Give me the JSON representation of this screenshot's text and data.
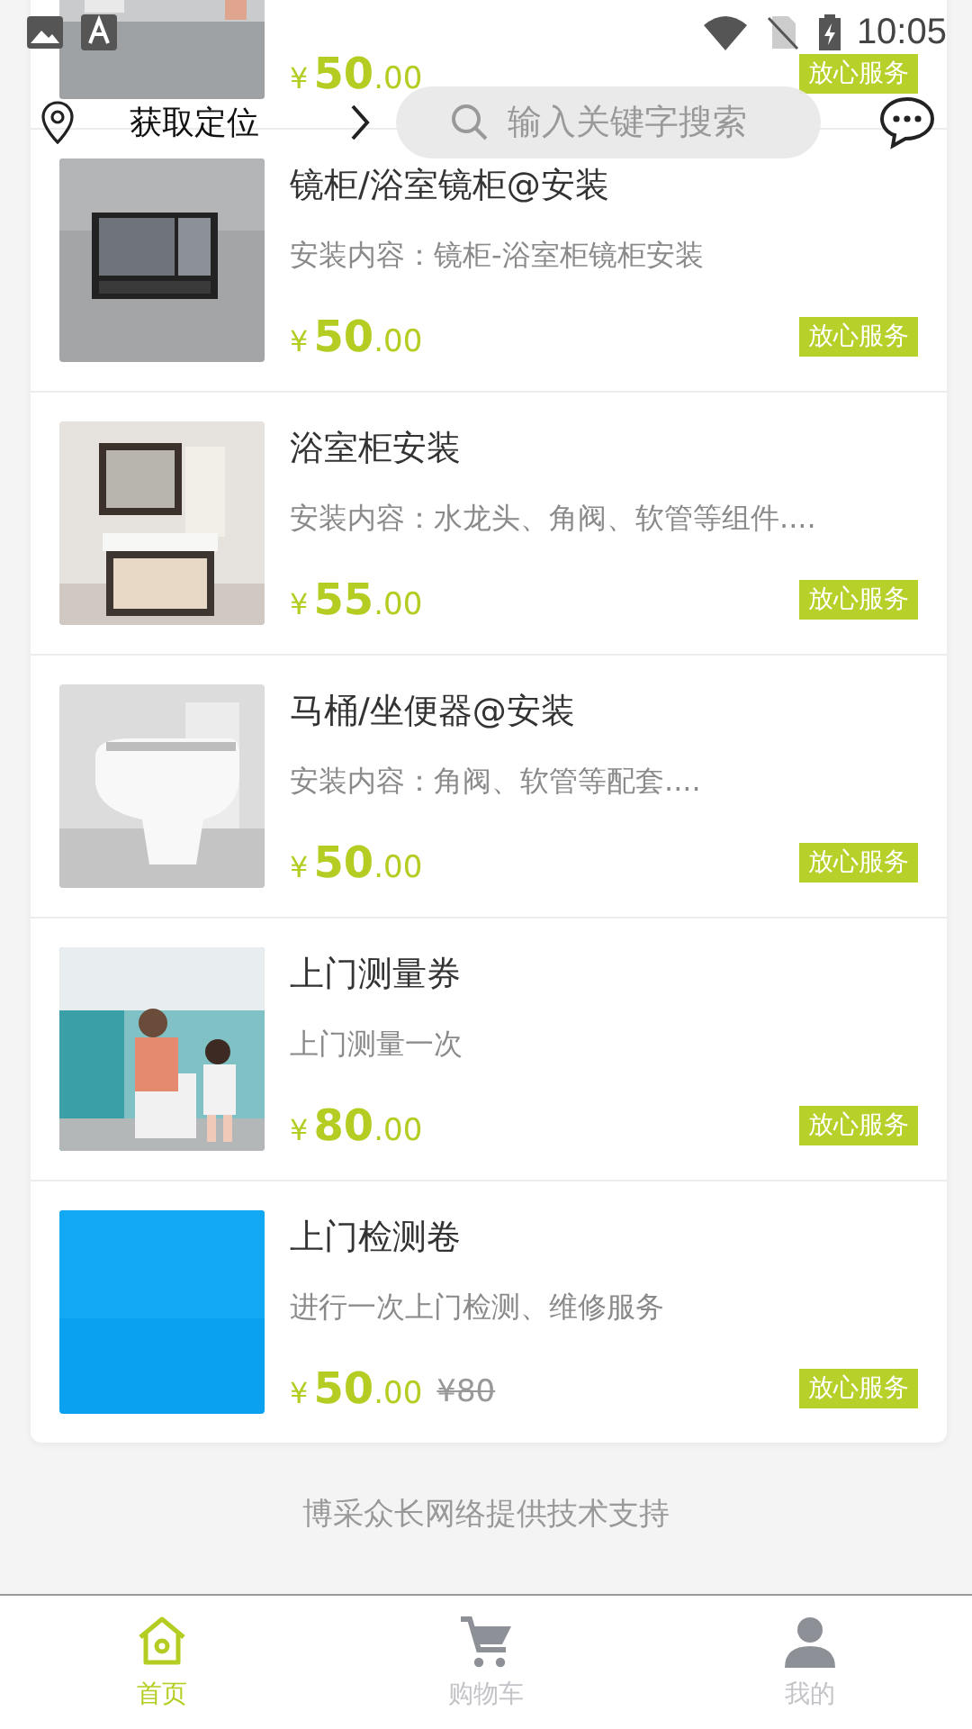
{
  "status_bar": {
    "time": "10:05"
  },
  "header": {
    "location": "获取定位",
    "search": {
      "placeholder": "输入关键字搜索"
    }
  },
  "items": [
    {
      "price": {
        "currency": "¥",
        "whole": "50",
        "cents": ".00"
      },
      "badge": "放心服务"
    },
    {
      "title": "镜柜/浴室镜柜@安装",
      "description": "安装内容：镜柜-浴室柜镜柜安装",
      "price": {
        "currency": "¥",
        "whole": "50",
        "cents": ".00"
      },
      "badge": "放心服务"
    },
    {
      "title": "浴室柜安装",
      "description": "安装内容：水龙头、角阀、软管等组件....",
      "price": {
        "currency": "¥",
        "whole": "55",
        "cents": ".00"
      },
      "badge": "放心服务"
    },
    {
      "title": "马桶/坐便器@安装",
      "description": "安装内容：角阀、软管等配套....",
      "price": {
        "currency": "¥",
        "whole": "50",
        "cents": ".00"
      },
      "badge": "放心服务"
    },
    {
      "title": "上门测量券",
      "description": "上门测量一次",
      "price": {
        "currency": "¥",
        "whole": "80",
        "cents": ".00"
      },
      "badge": "放心服务"
    },
    {
      "title": "上门检测卷",
      "description": "进行一次上门检测、维修服务",
      "price": {
        "currency": "¥",
        "whole": "50",
        "cents": ".00"
      },
      "original_price": "¥80",
      "badge": "放心服务"
    }
  ],
  "footer_note": "博采众长网络提供技术支持",
  "tabs": [
    {
      "label": "首页",
      "kind": "home",
      "selected": true
    },
    {
      "label": "购物车",
      "kind": "cart",
      "selected": false
    },
    {
      "label": "我的",
      "kind": "person",
      "selected": false
    }
  ]
}
